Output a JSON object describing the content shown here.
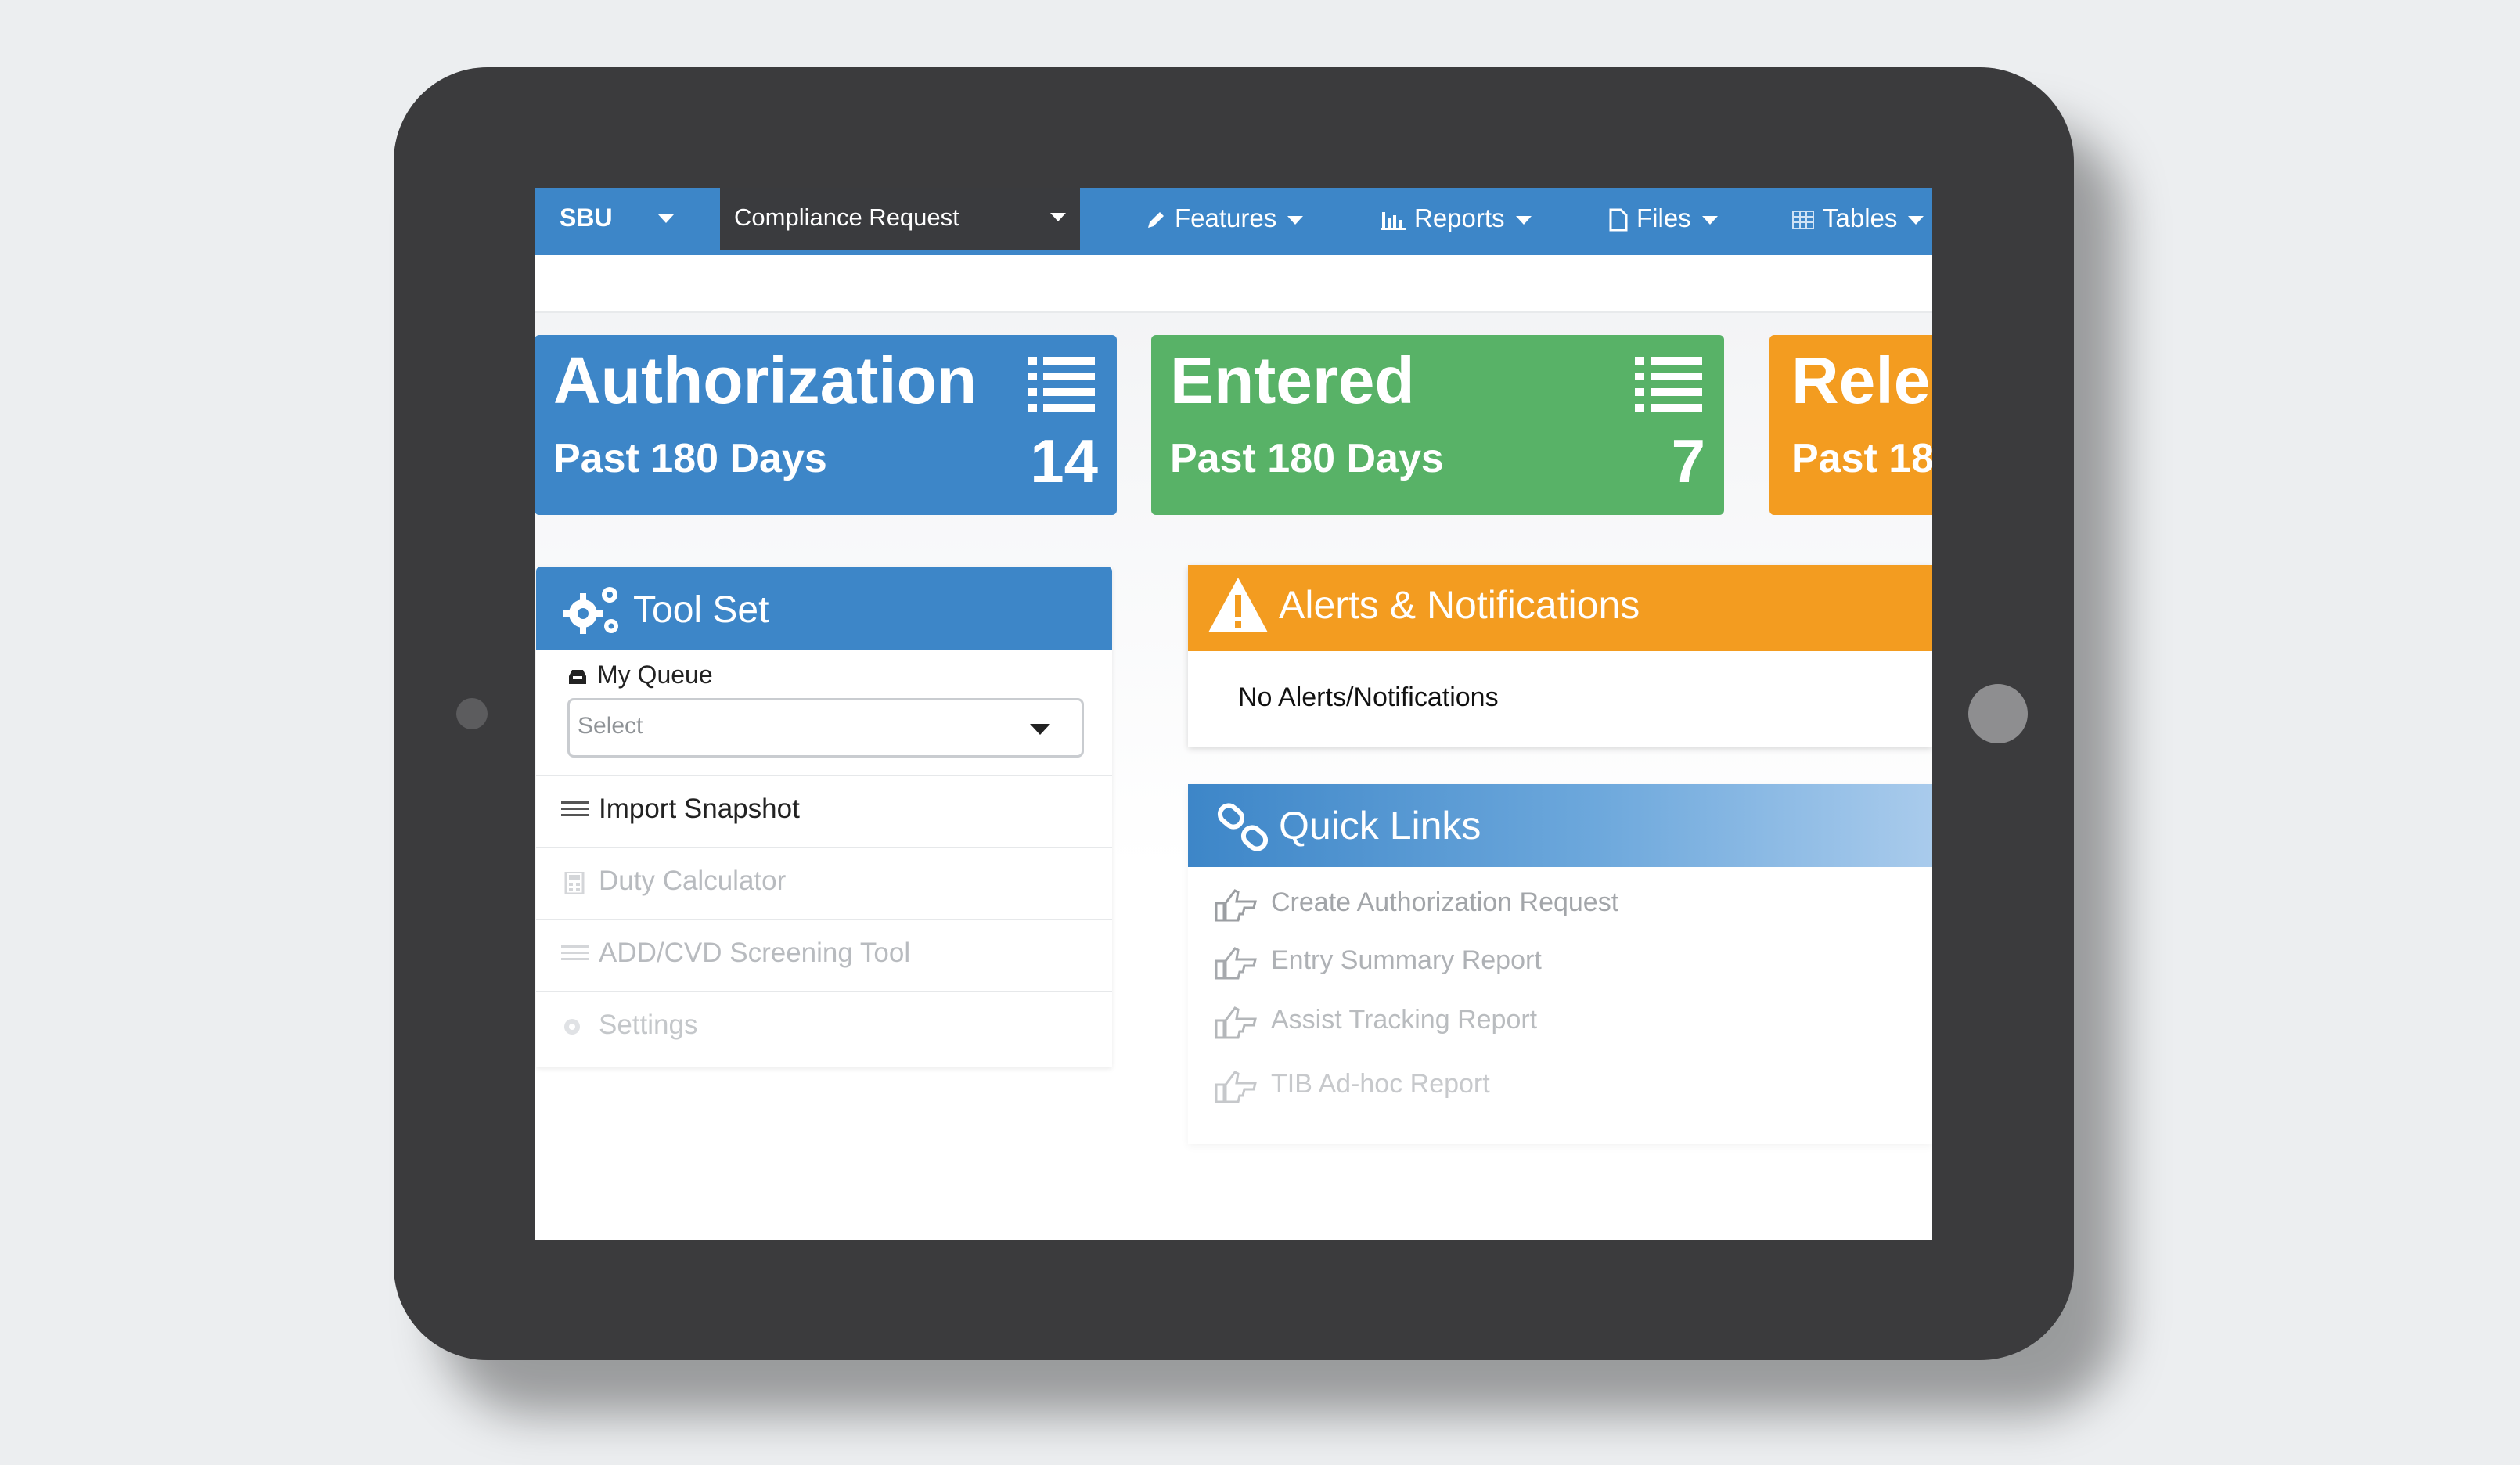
{
  "navbar": {
    "brand": "SBU",
    "selector": "Compliance Request",
    "items": [
      {
        "label": "Features",
        "icon": "pencil-icon"
      },
      {
        "label": "Reports",
        "icon": "bar-chart-icon"
      },
      {
        "label": "Files",
        "icon": "file-icon"
      },
      {
        "label": "Tables",
        "icon": "table-icon"
      }
    ]
  },
  "tiles": [
    {
      "title": "Authorization",
      "subtitle": "Past 180 Days",
      "count": "14",
      "color": "#3d86c8",
      "icon": "list-icon"
    },
    {
      "title": "Entered",
      "subtitle": "Past 180 Days",
      "count": "7",
      "color": "#58b267",
      "icon": "list-icon"
    },
    {
      "title": "Rele",
      "subtitle": "Past 18",
      "count": "",
      "color": "#f39c20"
    }
  ],
  "toolset": {
    "title": "Tool Set",
    "queue_label": "My Queue",
    "queue_select_placeholder": "Select",
    "items": [
      {
        "label": "Import Snapshot",
        "icon": "list-lines-icon",
        "enabled": true
      },
      {
        "label": "Duty Calculator",
        "icon": "calculator-icon",
        "enabled": false
      },
      {
        "label": "ADD/CVD Screening Tool",
        "icon": "list-lines-icon",
        "enabled": false
      },
      {
        "label": "Settings",
        "icon": "gear-icon",
        "enabled": false
      }
    ]
  },
  "alerts": {
    "title": "Alerts & Notifications",
    "body": "No Alerts/Notifications",
    "color": "#f39c20"
  },
  "quick_links": {
    "title": "Quick Links",
    "items": [
      {
        "label": "Create Authorization Request"
      },
      {
        "label": "Entry Summary Report"
      },
      {
        "label": "Assist Tracking Report"
      },
      {
        "label": "TIB Ad-hoc Report"
      }
    ]
  },
  "colors": {
    "primary": "#3d86c8",
    "success": "#58b267",
    "warning": "#f39c20",
    "device": "#3b3b3d"
  }
}
